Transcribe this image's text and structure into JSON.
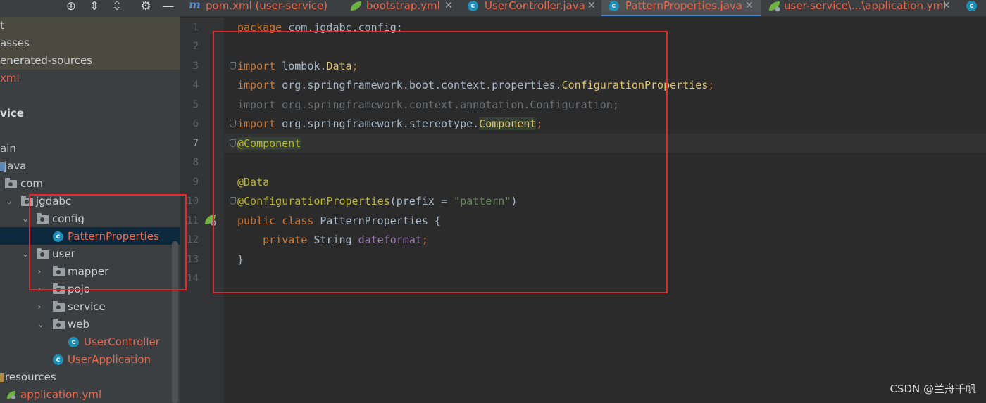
{
  "project": {
    "tree": [
      {
        "label": "t",
        "depth": "root",
        "kind": "text"
      },
      {
        "label": "asses",
        "depth": "root",
        "kind": "text"
      },
      {
        "label": "enerated-sources",
        "depth": "root",
        "kind": "text"
      },
      {
        "label": "xml",
        "depth": "root",
        "kind": "red"
      },
      {
        "label": "vice",
        "depth": "root",
        "kind": "bold"
      },
      {
        "label": "ain",
        "depth": "root",
        "kind": "text"
      },
      {
        "label": "java",
        "kind": "src"
      },
      {
        "label": "com",
        "kind": "pkg"
      },
      {
        "label": "jgdabc",
        "kind": "pkg",
        "expanded": true
      },
      {
        "label": "config",
        "kind": "pkg",
        "expanded": true
      },
      {
        "label": "PatternProperties",
        "kind": "class",
        "selected": true
      },
      {
        "label": "user",
        "kind": "pkg",
        "expanded": true
      },
      {
        "label": "mapper",
        "kind": "pkg",
        "expanded": false
      },
      {
        "label": "pojo",
        "kind": "pkg",
        "expanded": false
      },
      {
        "label": "service",
        "kind": "pkg",
        "expanded": false
      },
      {
        "label": "web",
        "kind": "pkg",
        "expanded": true
      },
      {
        "label": "UserController",
        "kind": "class"
      },
      {
        "label": "UserApplication",
        "kind": "boot-class"
      },
      {
        "label": "resources",
        "kind": "res"
      },
      {
        "label": "application.yml",
        "kind": "yml"
      }
    ]
  },
  "tabs": [
    {
      "label": "pom.xml (user-service)",
      "icon": "maven-icon",
      "active": false
    },
    {
      "label": "bootstrap.yml",
      "icon": "spring-leaf-icon",
      "active": false
    },
    {
      "label": "UserController.java",
      "icon": "class-icon",
      "active": false
    },
    {
      "label": "PatternProperties.java",
      "icon": "class-icon",
      "active": true
    },
    {
      "label": "user-service\\...\\application.yml",
      "icon": "spring-config-icon",
      "active": false
    }
  ],
  "editor": {
    "current_line": 7,
    "line_numbers": [
      "1",
      "2",
      "3",
      "4",
      "5",
      "6",
      "7",
      "8",
      "9",
      "10",
      "11",
      "12",
      "13",
      "14"
    ],
    "code": {
      "l1_kw": "package",
      "l1_rest": " com.jgdabc.config;",
      "l3_kw": "import",
      "l3_pkg": " lombok.",
      "l3_cls": "Data",
      "l3_end": ";",
      "l4_kw": "import",
      "l4_pkg": " org.springframework.boot.context.properties.",
      "l4_cls": "ConfigurationProperties",
      "l4_end": ";",
      "l5": "import org.springframework.context.annotation.Configuration;",
      "l6_kw": "import",
      "l6_pkg": " org.springframework.stereotype.",
      "l6_cls": "Component",
      "l6_end": ";",
      "l7_ann": "@Component",
      "l9_ann": "@Data",
      "l10_ann": "@ConfigurationProperties",
      "l10_open": "(prefix = ",
      "l10_str": "\"pattern\"",
      "l10_close": ")",
      "l11_kw": "public class",
      "l11_rest": " PatternProperties {",
      "l12_indent": "    ",
      "l12_kw": "private",
      "l12_type": " String ",
      "l12_field": "dateformat",
      "l12_end": ";",
      "l13": "}"
    }
  },
  "watermark": "CSDN @兰舟千帆",
  "colors": {
    "keyword": "#cc7832",
    "annotation": "#bbb529",
    "string": "#6a8759",
    "field": "#9876aa",
    "annotation_box": "#e0282e"
  }
}
